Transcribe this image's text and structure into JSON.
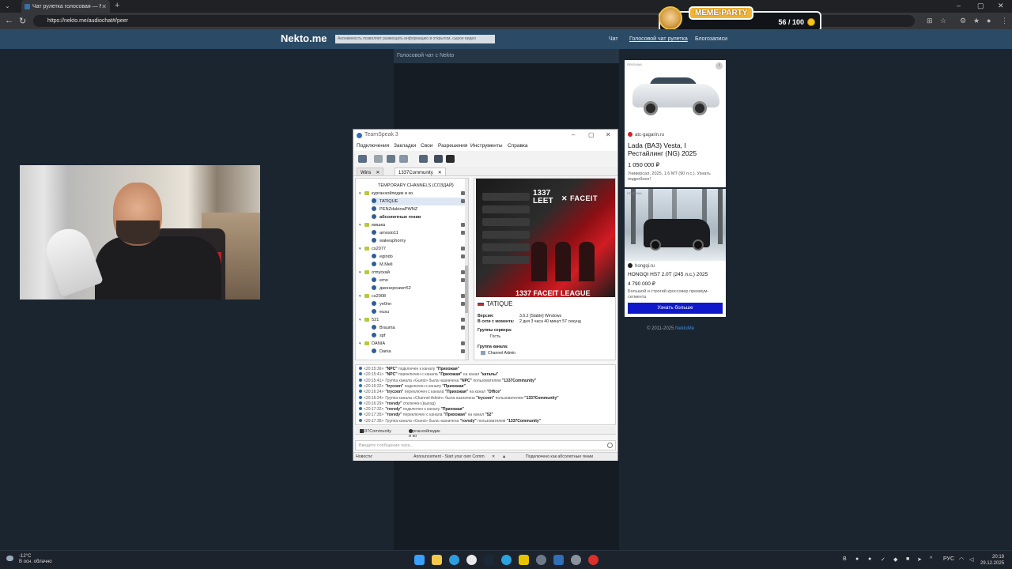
{
  "browser": {
    "tab_title": "Чат рулетка голосовая — Nekto.me",
    "url": "https://nekto.me/audiochat#/peer"
  },
  "meme_party": {
    "title": "MEME-PARTY",
    "count": "56 / 100"
  },
  "site": {
    "logo": "Nekto.me",
    "notice": "Анонимность позволяет размещать информацию в открытом, сырое видео",
    "nav": [
      "Чат",
      "Голосовой чат рулетка",
      "Блогозаписи"
    ],
    "chat_header": "Голосовой чат с Nekto",
    "copyright_prefix": "© 2011-2025 ",
    "copyright_link": "NektoMe"
  },
  "teamspeak": {
    "title": "TeamSpeak 3",
    "menu": [
      "Подключения",
      "Закладки",
      "Свои",
      "Разрешения",
      "Инструменты",
      "Справка"
    ],
    "tabs": [
      "Wins",
      "1337Community"
    ],
    "tree": [
      {
        "type": "spacer",
        "label": "TEMPORARY CHANNELS (СОЗДАЙ)"
      },
      {
        "type": "channel",
        "label": "курганхойпедик и ко"
      },
      {
        "type": "user",
        "label": "TATIQUE",
        "selected": true
      },
      {
        "type": "user",
        "label": "PENZdubinaPWNZ"
      },
      {
        "type": "user",
        "label": "абсолютные гении",
        "bold": true
      },
      {
        "type": "channel",
        "label": "мишка"
      },
      {
        "type": "user",
        "label": "amosio11"
      },
      {
        "type": "user",
        "label": "wakeuphorny"
      },
      {
        "type": "channel",
        "label": "cs2077"
      },
      {
        "type": "user",
        "label": "egindo"
      },
      {
        "type": "user",
        "label": "M.Mell"
      },
      {
        "type": "channel",
        "label": "отпускай"
      },
      {
        "type": "user",
        "label": "emo"
      },
      {
        "type": "user",
        "label": "джонерскиит52"
      },
      {
        "type": "channel",
        "label": "cs2008"
      },
      {
        "type": "user",
        "label": "ye0nn"
      },
      {
        "type": "user",
        "label": "eusu"
      },
      {
        "type": "channel",
        "label": "521"
      },
      {
        "type": "user",
        "label": "Brauma"
      },
      {
        "type": "user",
        "label": "spf"
      },
      {
        "type": "channel",
        "label": "DANIA"
      },
      {
        "type": "user",
        "label": "Dania"
      }
    ],
    "banner": {
      "brand": "1337\nLEET",
      "partner": "✕ FACEIT",
      "league": "1337 FACEIT LEAGUE"
    },
    "user_info": {
      "name": "TATIQUE",
      "version_label": "Версия:",
      "version_value": "3.6.2 [Stable] Windows",
      "online_label": "В сети с момента:",
      "online_value": "2 дня 3 часа 40 минут 57 секунд",
      "server_groups_label": "Группы сервера:",
      "server_group": "Гость",
      "channel_group_label": "Группа канала:",
      "channel_group": "Channel Admin"
    },
    "log": [
      {
        "t": "<20:15:36>",
        "b1": "\"NPC\"",
        "m1": " подключен к каналу ",
        "b2": "\"Прихожая\""
      },
      {
        "t": "<20:15:41>",
        "b1": "\"NPC\"",
        "m1": " переключен с канала ",
        "b2": "\"Прихожая\"",
        "m2": " на канал ",
        "b3": "\"каталы\""
      },
      {
        "t": "<20:15:41>",
        "m0": "Группа канала «Guest» была назначена ",
        "b1": "\"NPC\"",
        "m1": " пользователем ",
        "b2": "\"1337Community\""
      },
      {
        "t": "<20:16:22>",
        "b1": "\"trycoon\"",
        "m1": " подключен к каналу ",
        "b2": "\"Прихожая\""
      },
      {
        "t": "<20:16:24>",
        "b1": "\"trycoon\"",
        "m1": " переключен с канала ",
        "b2": "\"Прихожая\"",
        "m2": " на канал ",
        "b3": "\"Office\""
      },
      {
        "t": "<20:16:24>",
        "m0": "Группа канала «Channel Admin» была назначена ",
        "b1": "\"trycoon\"",
        "m1": " пользователем ",
        "b2": "\"1337Community\""
      },
      {
        "t": "<20:16:29>",
        "b1": "\"rovvdy\"",
        "m1": " отключен (выход)"
      },
      {
        "t": "<20:17:32>",
        "b1": "\"rovvdy\"",
        "m1": " подключен к каналу ",
        "b2": "\"Прихожая\""
      },
      {
        "t": "<20:17:35>",
        "b1": "\"rovvdy\"",
        "m1": " переключен с канала ",
        "b2": "\"Прихожая\"",
        "m2": " на канал ",
        "b3": "\"52\""
      },
      {
        "t": "<20:17:35>",
        "m0": "Группа канала «Guest» была назначена ",
        "b1": "\"rovvdy\"",
        "m1": " пользователем ",
        "b2": "\"1337Community\""
      }
    ],
    "chat_tabs": [
      "1337Community",
      "курганхойпедик и ко"
    ],
    "chat_placeholder": "Введите сообщение чата...",
    "status": {
      "news": "Новости:",
      "announcement": "Announcement - Start your own Comm",
      "connected": "Подключено как абсолютные гении"
    }
  },
  "ads": {
    "badge": "РЕКЛАМА",
    "ad1": {
      "source": "atc-gagarin.ru",
      "title": "Lada (ВАЗ) Vesta, I Рестайлинг (NG) 2025",
      "price": "1 050 000 ₽",
      "desc": "Универсал, 2025, 1.6 MT (90 л.с.). Узнать подробнее!"
    },
    "ad2": {
      "source": "hongqi.ru",
      "title": "HONGQI HS7 2.0T (245 л.с.) 2025",
      "price": "4 790 000 ₽",
      "desc": "Большой и строгий кроссовер премиум-сегмента",
      "button": "Узнать больше"
    }
  },
  "taskbar": {
    "temp": "-12°C",
    "weather": "В осн. облачно",
    "lang": "РУС",
    "time": "20:19",
    "date": "29.12.2025"
  }
}
